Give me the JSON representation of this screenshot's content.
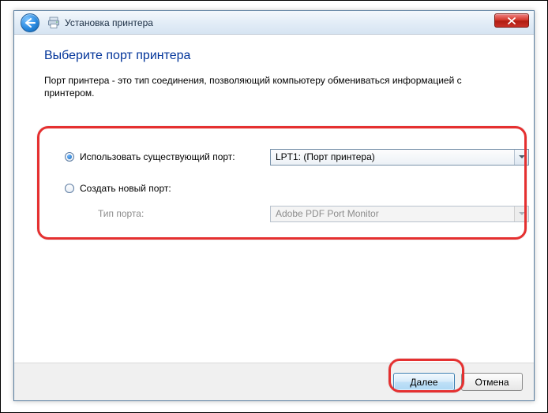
{
  "titlebar": {
    "text": "Установка принтера"
  },
  "content": {
    "heading": "Выберите порт принтера",
    "description": "Порт принтера - это тип соединения, позволяющий компьютеру обмениваться информацией с принтером."
  },
  "form": {
    "opt_existing": "Использовать существующий порт:",
    "port_select": "LPT1: (Порт принтера)",
    "opt_new": "Создать новый порт:",
    "type_label": "Тип порта:",
    "type_select": "Adobe PDF Port Monitor"
  },
  "footer": {
    "next": "Далее",
    "cancel": "Отмена"
  }
}
